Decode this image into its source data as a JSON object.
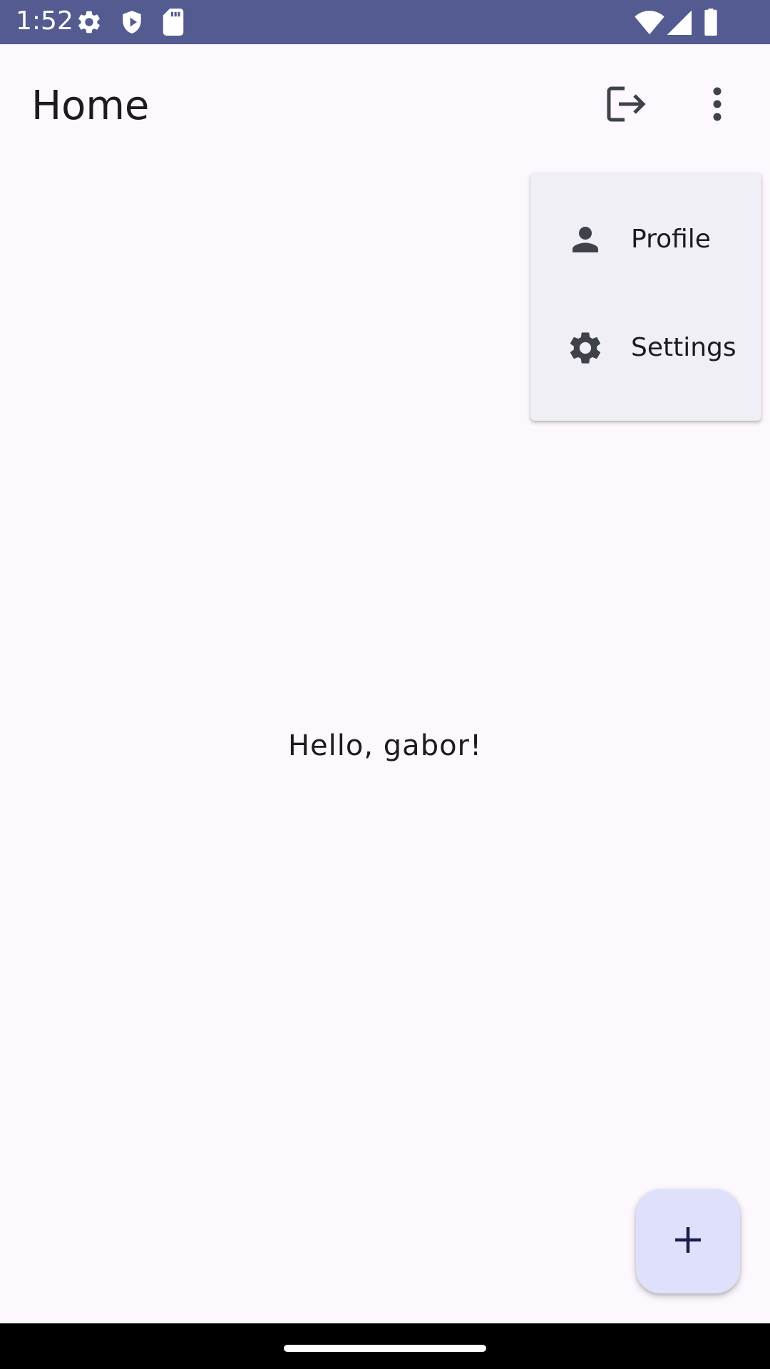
{
  "status_bar": {
    "time": "1:52",
    "left_icons": [
      "gear-icon",
      "shield-icon",
      "sd-card-icon"
    ],
    "right_icons": [
      "wifi-icon",
      "cell-signal-icon",
      "battery-icon"
    ],
    "background": "#535b91"
  },
  "app_bar": {
    "title": "Home",
    "actions": [
      "logout-icon",
      "more-vert-icon"
    ]
  },
  "menu": {
    "items": [
      {
        "label": "Profile",
        "icon": "person-icon"
      },
      {
        "label": "Settings",
        "icon": "gear-icon"
      }
    ]
  },
  "main": {
    "greeting": "Hello, gabor!"
  },
  "fab": {
    "icon": "plus-icon",
    "background": "#dfe0fb"
  },
  "colors": {
    "background": "#fcf8fd",
    "menu_background": "#f0eff5",
    "icon_dark": "#3f4249"
  }
}
